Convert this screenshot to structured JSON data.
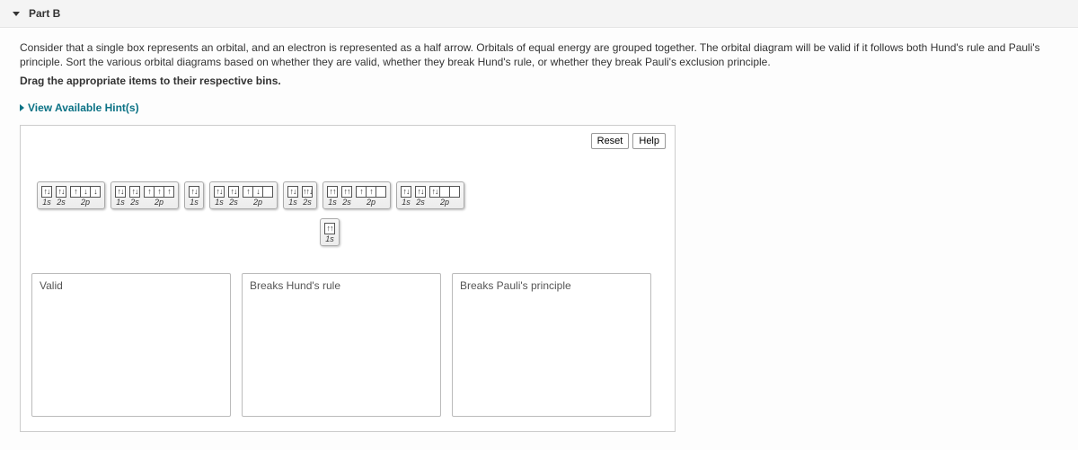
{
  "header": {
    "part_label": "Part B"
  },
  "prompt": {
    "text": "Consider that a single box represents an orbital, and an electron is represented as a half arrow. Orbitals of equal energy are grouped together. The orbital diagram will be valid if it follows both Hund's rule and Pauli's principle. Sort the various orbital diagrams based on whether they are valid, whether they break Hund's rule, or whether they break Pauli's exclusion principle.",
    "instruction": "Drag the appropriate items to their respective bins.",
    "hints_label": "View Available Hint(s)"
  },
  "buttons": {
    "reset": "Reset",
    "help": "Help"
  },
  "arrows": {
    "up": "↑",
    "down": "↓",
    "pair": "↑↓",
    "none": ""
  },
  "tiles": [
    {
      "id": "t1",
      "groups": [
        {
          "label": "1s",
          "boxes": [
            "pair"
          ]
        },
        {
          "label": "2s",
          "boxes": [
            "pair"
          ]
        },
        {
          "label": "2p",
          "boxes": [
            "up",
            "down",
            "down"
          ]
        }
      ]
    },
    {
      "id": "t2",
      "groups": [
        {
          "label": "1s",
          "boxes": [
            "pair"
          ]
        },
        {
          "label": "2s",
          "boxes": [
            "pair"
          ]
        },
        {
          "label": "2p",
          "boxes": [
            "up",
            "up",
            "up"
          ]
        }
      ]
    },
    {
      "id": "t3",
      "groups": [
        {
          "label": "1s",
          "boxes": [
            "pair"
          ]
        }
      ]
    },
    {
      "id": "t4",
      "groups": [
        {
          "label": "1s",
          "boxes": [
            "pair"
          ]
        },
        {
          "label": "2s",
          "boxes": [
            "pair"
          ]
        },
        {
          "label": "2p",
          "boxes": [
            "up",
            "down",
            ""
          ]
        }
      ]
    },
    {
      "id": "t5",
      "groups": [
        {
          "label": "1s",
          "boxes": [
            "pair"
          ]
        },
        {
          "label": "2s",
          "boxes": [
            "↑↑↓"
          ]
        }
      ]
    },
    {
      "id": "t6",
      "groups": [
        {
          "label": "1s",
          "boxes": [
            "↑↑"
          ]
        },
        {
          "label": "2s",
          "boxes": [
            "↑↑"
          ]
        },
        {
          "label": "2p",
          "boxes": [
            "up",
            "up",
            ""
          ]
        }
      ]
    },
    {
      "id": "t7",
      "groups": [
        {
          "label": "1s",
          "boxes": [
            "pair"
          ]
        },
        {
          "label": "2s",
          "boxes": [
            "pair"
          ]
        },
        {
          "label": "2p",
          "boxes": [
            "pair",
            "",
            ""
          ]
        }
      ]
    },
    {
      "id": "t8",
      "groups": [
        {
          "label": "1s",
          "boxes": [
            "↑↑"
          ]
        }
      ]
    }
  ],
  "bins": [
    {
      "title": "Valid"
    },
    {
      "title": "Breaks Hund's rule"
    },
    {
      "title": "Breaks Pauli's principle"
    }
  ]
}
